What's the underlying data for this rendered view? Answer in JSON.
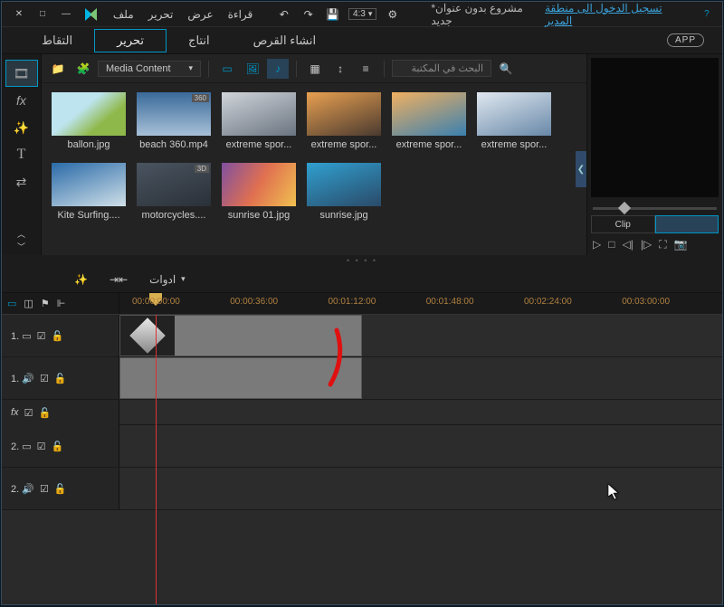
{
  "window": {
    "close": "✕",
    "max": "□",
    "min": "—",
    "help": "?"
  },
  "menu": [
    "ملف",
    "تحرير",
    "عرض",
    "قراءة"
  ],
  "titlebar": {
    "undo": "↶",
    "redo": "↷",
    "save": "💾",
    "aspect": "4:3",
    "settings": "⚙",
    "project": "*مشروع بدون عنوان جديد",
    "signin": "تسجيل الدخول الى منطقة المدير",
    "app_badge": "APP"
  },
  "rooms": {
    "capture": "التقاط",
    "edit": "تحرير",
    "produce": "انتاج",
    "disc": "انشاء القرص"
  },
  "sidetools": {
    "media": "🎞",
    "fx": "fx",
    "particle": "✨",
    "title": "T",
    "transition": "⇄"
  },
  "library": {
    "import": "📁",
    "plugin": "🧩",
    "dropdown": "Media Content",
    "filter_video": "▭",
    "filter_image": "🖼",
    "filter_audio": "♪",
    "grid_view": "▦",
    "sort": "↕",
    "menu": "≡",
    "search_placeholder": "البحث في المكتبة",
    "search_icon": "🔍",
    "items": [
      {
        "label": "ballon.jpg",
        "badge": ""
      },
      {
        "label": "beach 360.mp4",
        "badge": "360"
      },
      {
        "label": "extreme spor...",
        "badge": ""
      },
      {
        "label": "extreme spor...",
        "badge": ""
      },
      {
        "label": "extreme spor...",
        "badge": ""
      },
      {
        "label": "extreme spor...",
        "badge": ""
      },
      {
        "label": "Kite Surfing....",
        "badge": ""
      },
      {
        "label": "motorcycles....",
        "badge": "3D"
      },
      {
        "label": "sunrise 01.jpg",
        "badge": ""
      },
      {
        "label": "sunrise.jpg",
        "badge": ""
      }
    ]
  },
  "preview": {
    "clip": "Clip",
    "play": "▷",
    "stop": "□",
    "prev": "◁|",
    "next": "|▷",
    "full": "⛶",
    "snap": "📷"
  },
  "tools": {
    "magic": "✨",
    "split": "⇥⇤",
    "label": "ادوات"
  },
  "ruler": {
    "viewmode": "▭",
    "fit": "◫",
    "markers": "⚑",
    "snap": "⊩",
    "ticks": [
      "00:00:00:00",
      "00:00:36:00",
      "00:01:12:00",
      "00:01:48:00",
      "00:02:24:00",
      "00:03:00:00"
    ]
  },
  "tracks": {
    "t1v": "1. ▭",
    "t1a": "1. 🔊",
    "fx": "fx",
    "t2v": "2. ▭",
    "t2a": "2. 🔊",
    "check": "☑",
    "lock": "🔓"
  }
}
